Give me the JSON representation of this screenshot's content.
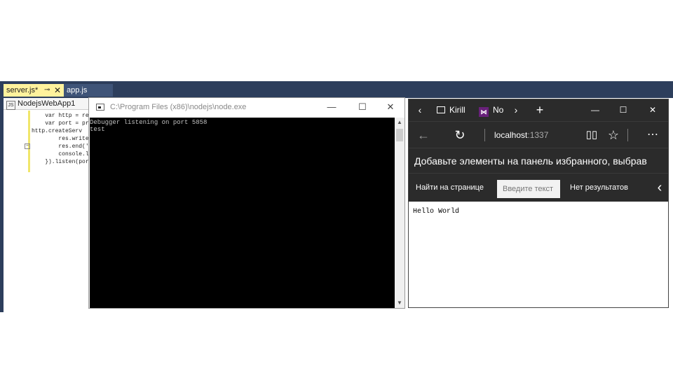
{
  "vs": {
    "tabs": [
      {
        "label": "server.js*",
        "pin": "⊸",
        "close": "✕"
      },
      {
        "label": "app.js"
      }
    ],
    "project_name": "NodejsWebApp1",
    "code_lines": [
      "    var http = requ",
      "    var port = proc",
      "http.createServ",
      "        res.writeHe",
      "        res.end('Ho",
      "        console.log",
      "    }).listen(port);"
    ]
  },
  "console": {
    "title": "C:\\Program Files (x86)\\nodejs\\node.exe",
    "output_lines": [
      "Debugger listening on port 5858",
      "test"
    ],
    "buttons": {
      "minimize": "—",
      "maximize": "☐",
      "close": "✕"
    }
  },
  "edge": {
    "tabs": [
      {
        "label": "Kirill"
      },
      {
        "label": "No"
      }
    ],
    "address": {
      "host": "localhost",
      "port": ":1337"
    },
    "favorites_hint": "Добавьте элементы на панель избранного, выбрав",
    "find": {
      "label": "Найти на странице",
      "placeholder": "Введите текст",
      "result": "Нет результатов"
    },
    "page_content": "Hello World",
    "window_buttons": {
      "minimize": "—",
      "maximize": "☐",
      "close": "✕"
    },
    "new_tab": "+"
  },
  "colors": {
    "vs_frame": "#2d3e5c",
    "vs_active_tab": "#fff29d",
    "edge_chrome": "#2b2b2b",
    "console_bg": "#000000"
  }
}
